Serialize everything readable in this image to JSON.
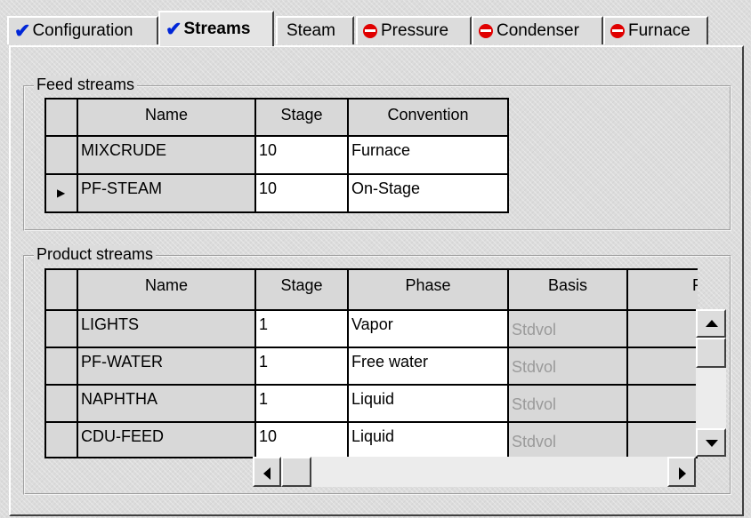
{
  "tabs": [
    {
      "label": "Configuration",
      "status": "check"
    },
    {
      "label": "Streams",
      "status": "check",
      "active": true
    },
    {
      "label": "Steam",
      "status": "none"
    },
    {
      "label": "Pressure",
      "status": "required"
    },
    {
      "label": "Condenser",
      "status": "required"
    },
    {
      "label": "Furnace",
      "status": "required"
    }
  ],
  "feed_streams": {
    "legend": "Feed streams",
    "columns": [
      "Name",
      "Stage",
      "Convention"
    ],
    "rows": [
      {
        "name": "MIXCRUDE",
        "stage": "10",
        "convention": "Furnace"
      },
      {
        "name": "PF-STEAM",
        "stage": "10",
        "convention": "On-Stage"
      }
    ],
    "current_row_marker": "▶"
  },
  "product_streams": {
    "legend": "Product streams",
    "columns": [
      "Name",
      "Stage",
      "Phase",
      "Basis",
      "Flow"
    ],
    "rows": [
      {
        "name": "LIGHTS",
        "stage": "1",
        "phase": "Vapor",
        "basis": "Stdvol",
        "flow": ""
      },
      {
        "name": "PF-WATER",
        "stage": "1",
        "phase": "Free water",
        "basis": "Stdvol",
        "flow": ""
      },
      {
        "name": "NAPHTHA",
        "stage": "1",
        "phase": "Liquid",
        "basis": "Stdvol",
        "flow": ""
      },
      {
        "name": "CDU-FEED",
        "stage": "10",
        "phase": "Liquid",
        "basis": "Stdvol",
        "flow": ""
      }
    ]
  },
  "colors": {
    "check": "#0026d8",
    "required": "#e00000",
    "disabled_text": "#9a9a9a"
  },
  "icons": {
    "check": "check-icon",
    "required": "required-input-icon",
    "row_pointer": "row-pointer-icon"
  }
}
